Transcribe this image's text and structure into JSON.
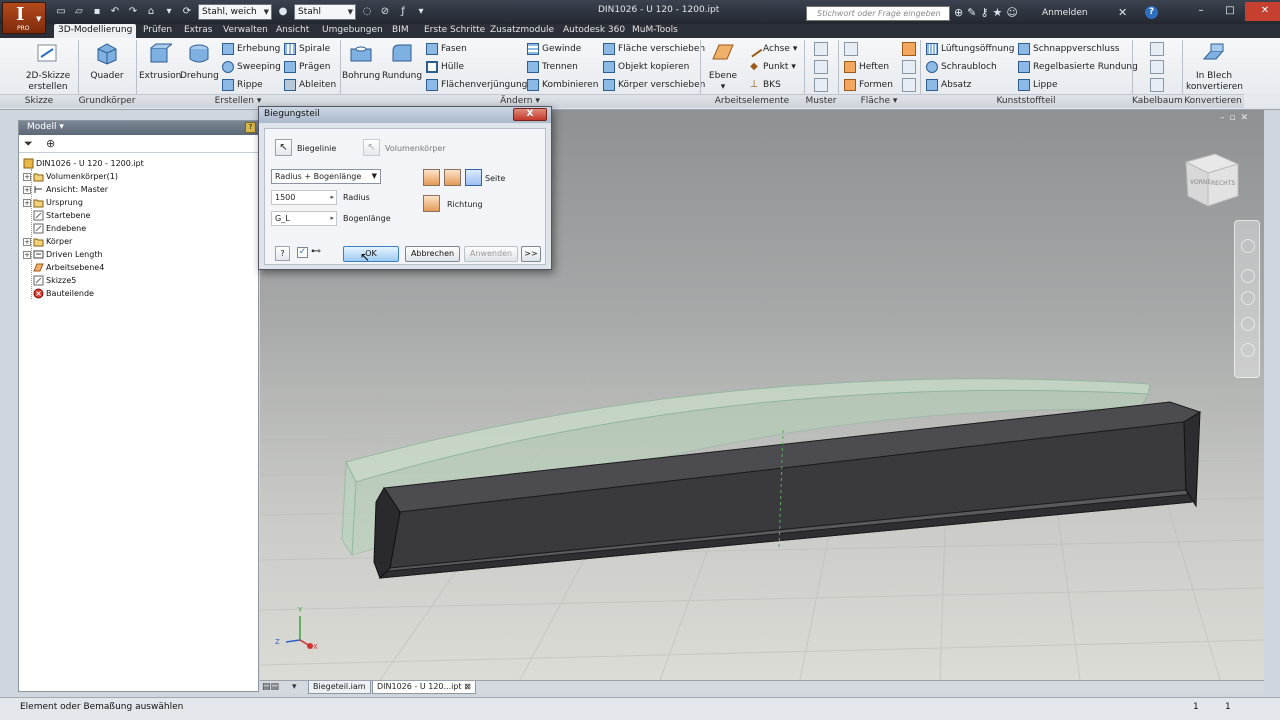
{
  "app": {
    "logo_letter": "I",
    "logo_sub": "PRO",
    "document_title": "DIN1026 - U 120 - 1200.ipt",
    "material": "Stahl, weich",
    "appearance": "Stahl",
    "search_placeholder": "Stichwort oder Frage eingeben",
    "sign_in": "Anmelden",
    "help": "?"
  },
  "tabs": [
    {
      "label": "3D-Modellierung",
      "active": true
    },
    {
      "label": "Prüfen"
    },
    {
      "label": "Extras"
    },
    {
      "label": "Verwalten"
    },
    {
      "label": "Ansicht"
    },
    {
      "label": "Umgebungen"
    },
    {
      "label": "BIM"
    },
    {
      "label": "Erste Schritte"
    },
    {
      "label": "Zusatzmodule"
    },
    {
      "label": "Autodesk 360"
    },
    {
      "label": "MuM-Tools"
    }
  ],
  "ribbon": {
    "skizze": {
      "button_line1": "2D-Skizze",
      "button_line2": "erstellen",
      "footer": "Skizze"
    },
    "grundkoerper": {
      "button": "Quader",
      "footer": "Grundkörper"
    },
    "erstellen": {
      "extrusion": "Extrusion",
      "drehung": "Drehung",
      "erhebung": "Erhebung",
      "sweeping": "Sweeping",
      "rippe": "Rippe",
      "spirale": "Spirale",
      "praegen": "Prägen",
      "ableiten": "Ableiten",
      "footer": "Erstellen"
    },
    "aendern": {
      "bohrung": "Bohrung",
      "rundung": "Rundung",
      "fasen": "Fasen",
      "huelle": "Hülle",
      "flaechenverjuengung": "Flächenverjüngung",
      "gewinde": "Gewinde",
      "trennen": "Trennen",
      "kombinieren": "Kombinieren",
      "flaeche_verschieben": "Fläche verschieben",
      "objekt_kopieren": "Objekt kopieren",
      "koerper_verschieben": "Körper verschieben",
      "footer": "Ändern"
    },
    "arbeitselemente": {
      "ebene": "Ebene",
      "achse": "Achse",
      "punkt": "Punkt",
      "bks": "BKS",
      "footer": "Arbeitselemente"
    },
    "muster": {
      "footer": "Muster"
    },
    "flaeche": {
      "heften": "Heften",
      "formen": "Formen",
      "footer": "Fläche"
    },
    "kunststoffteil": {
      "lueftungsoeffnung": "Lüftungsöffnung",
      "schraubloch": "Schraubloch",
      "absatz": "Absatz",
      "schnappverschluss": "Schnappverschluss",
      "regelbasierte_rundung": "Regelbasierte Rundung",
      "lippe": "Lippe",
      "footer": "Kunststoffteil"
    },
    "kabelbaum": {
      "footer": "Kabelbaum"
    },
    "konvertieren": {
      "button_line1": "In Blech",
      "button_line2": "konvertieren",
      "footer": "Konvertieren"
    }
  },
  "browser": {
    "title": "Modell",
    "help": "?",
    "tree": [
      {
        "label": "DIN1026 - U 120 - 1200.ipt",
        "icon": "part-icon",
        "level": 0,
        "expander": ""
      },
      {
        "label": "Volumenkörper(1)",
        "icon": "folder-icon",
        "level": 1,
        "expander": "+"
      },
      {
        "label": "Ansicht: Master",
        "icon": "view-icon",
        "level": 1,
        "expander": "+"
      },
      {
        "label": "Ursprung",
        "icon": "folder-icon",
        "level": 1,
        "expander": "+"
      },
      {
        "label": "Startebene",
        "icon": "sketch-icon",
        "level": 1,
        "expander": ""
      },
      {
        "label": "Endebene",
        "icon": "sketch-icon",
        "level": 1,
        "expander": ""
      },
      {
        "label": "Körper",
        "icon": "folder-icon",
        "level": 1,
        "expander": "+"
      },
      {
        "label": "Driven Length",
        "icon": "parameter-icon",
        "level": 1,
        "expander": "+"
      },
      {
        "label": "Arbeitsebene4",
        "icon": "workplane-icon",
        "level": 1,
        "expander": ""
      },
      {
        "label": "Skizze5",
        "icon": "sketch-icon",
        "level": 1,
        "expander": ""
      },
      {
        "label": "Bauteilende",
        "icon": "end-of-part-icon",
        "level": 1,
        "expander": ""
      }
    ]
  },
  "dialog": {
    "title": "Biegungsteil",
    "close": "X",
    "biegelinie": "Biegelinie",
    "volumenkoerper": "Volumenkörper",
    "method": "Radius + Bogenlänge",
    "radius_value": "1500",
    "radius_label": "Radius",
    "bogen_value": "G_L",
    "bogen_label": "Bogenlänge",
    "seite": "Seite",
    "richtung": "Richtung",
    "ok": "OK",
    "abbrechen": "Abbrechen",
    "anwenden": "Anwenden",
    "more": ">>",
    "help": "?"
  },
  "viewcube": {
    "face_front": "VORNE",
    "face_right": "RECHTS"
  },
  "triad": {
    "x": "X",
    "y": "Y",
    "z": "Z"
  },
  "doc_tabs": [
    {
      "label": "Biegeteil.iam"
    },
    {
      "label": "DIN1026 - U 120...ipt",
      "active": true
    }
  ],
  "status": {
    "text": "Element oder Bemaßung auswählen",
    "num1": "1",
    "num2": "1"
  },
  "colors": {
    "accent": "#2e6fc0",
    "app_orange": "#b44a1c",
    "dialog_bg": "#dfe4ea"
  }
}
